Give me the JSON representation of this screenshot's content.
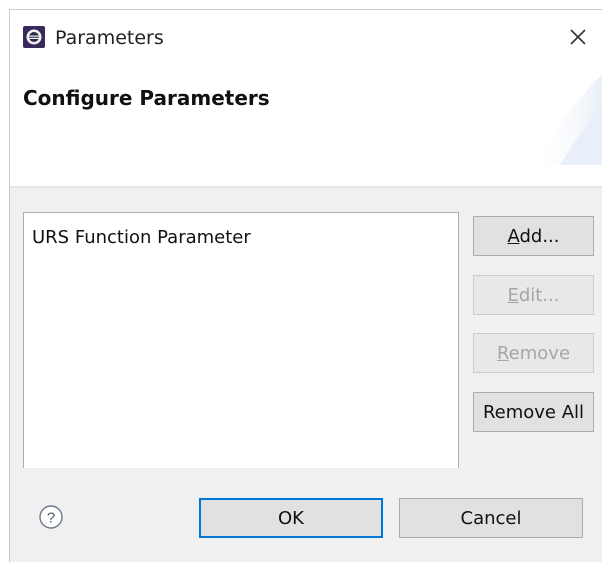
{
  "window": {
    "title": "Parameters"
  },
  "banner": {
    "title": "Configure Parameters"
  },
  "list": {
    "items": [
      "URS Function Parameter"
    ]
  },
  "side_buttons": {
    "add": {
      "pre": "",
      "mnemonic": "A",
      "post": "dd..."
    },
    "edit": {
      "pre": "",
      "mnemonic": "E",
      "post": "dit..."
    },
    "remove": {
      "pre": "",
      "mnemonic": "R",
      "post": "emove"
    },
    "remove_all": {
      "label": "Remove All"
    }
  },
  "footer": {
    "ok_label": "OK",
    "cancel_label": "Cancel"
  },
  "colors": {
    "focus_border": "#0078d7",
    "disabled_text": "#a6a6a6",
    "button_face": "#e1e1e1",
    "dialog_bg": "#f0f0f0"
  },
  "icons": {
    "app": "eclipse-app-icon",
    "close": "close-icon",
    "help": "help-icon"
  }
}
